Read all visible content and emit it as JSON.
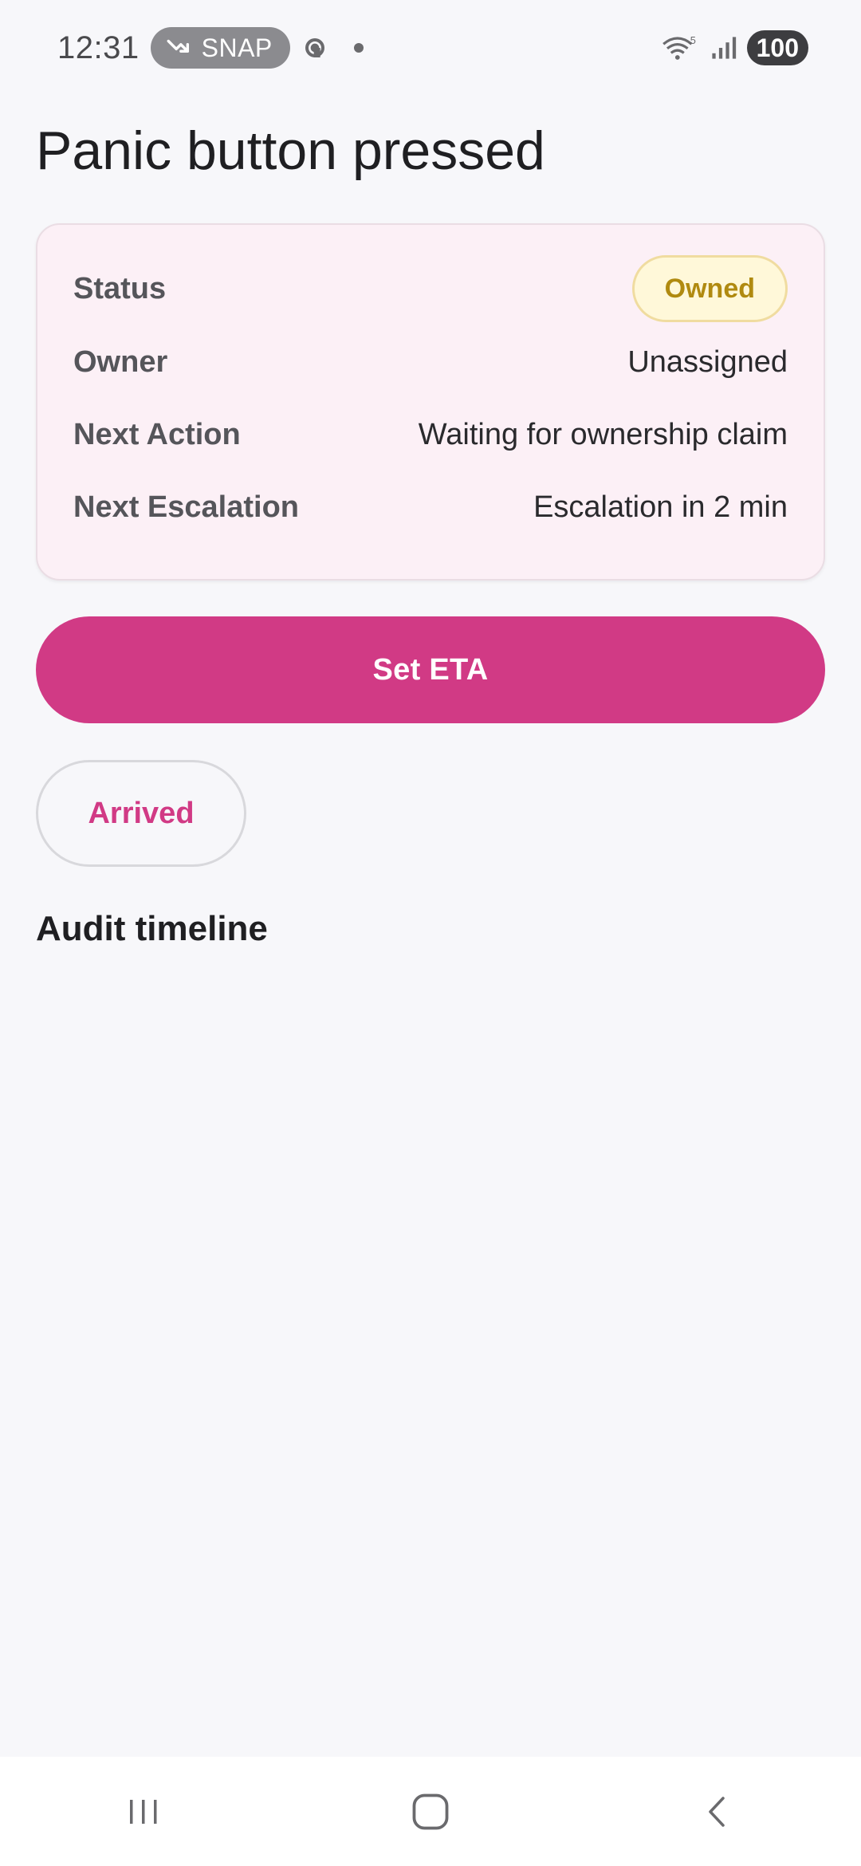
{
  "status_bar": {
    "time": "12:31",
    "snap_label": "SNAP",
    "battery": "100",
    "signal_label": "5"
  },
  "page": {
    "title": "Panic button pressed"
  },
  "card": {
    "rows": [
      {
        "label": "Status",
        "value": "Owned"
      },
      {
        "label": "Owner",
        "value": "Unassigned"
      },
      {
        "label": "Next Action",
        "value": "Waiting for ownership claim"
      },
      {
        "label": "Next Escalation",
        "value": "Escalation in 2 min"
      }
    ]
  },
  "actions": {
    "primary_label": "Set ETA",
    "secondary_label": "Arrived"
  },
  "timeline": {
    "title": "Audit timeline"
  },
  "colors": {
    "accent": "#d13a85",
    "card_bg": "#fcf0f6",
    "badge_bg": "#fff8d9",
    "badge_text": "#b08a10"
  },
  "icons": {
    "recents": "recents-icon",
    "home": "home-icon",
    "back": "back-icon"
  }
}
